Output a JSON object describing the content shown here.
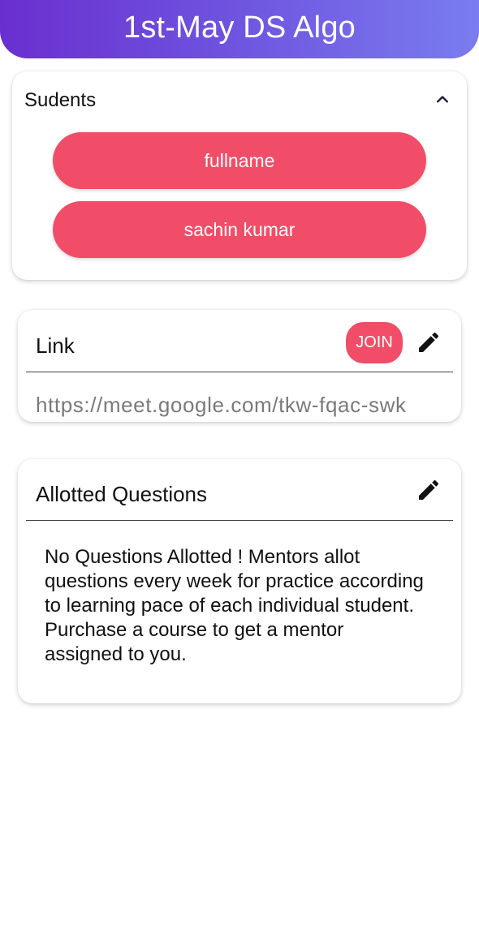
{
  "header": {
    "title": "1st-May DS Algo"
  },
  "students": {
    "title": "Sudents",
    "collapse_icon": "chevron-up-icon",
    "items": [
      {
        "name": "fullname"
      },
      {
        "name": "sachin kumar"
      }
    ]
  },
  "link": {
    "title": "Link",
    "join_label": "JOIN",
    "edit_icon": "pencil-icon",
    "url": "https://meet.google.com/tkw-fqac-swk"
  },
  "questions": {
    "title": "Allotted Questions",
    "edit_icon": "pencil-icon",
    "message": "No Questions Allotted ! Mentors allot questions every week for practice according to learning pace of each individual student. Purchase a course to get a mentor assigned to you."
  },
  "colors": {
    "header_gradient_start": "#6a2fcf",
    "header_gradient_end": "#7a7cef",
    "accent_button": "#f14d68"
  }
}
